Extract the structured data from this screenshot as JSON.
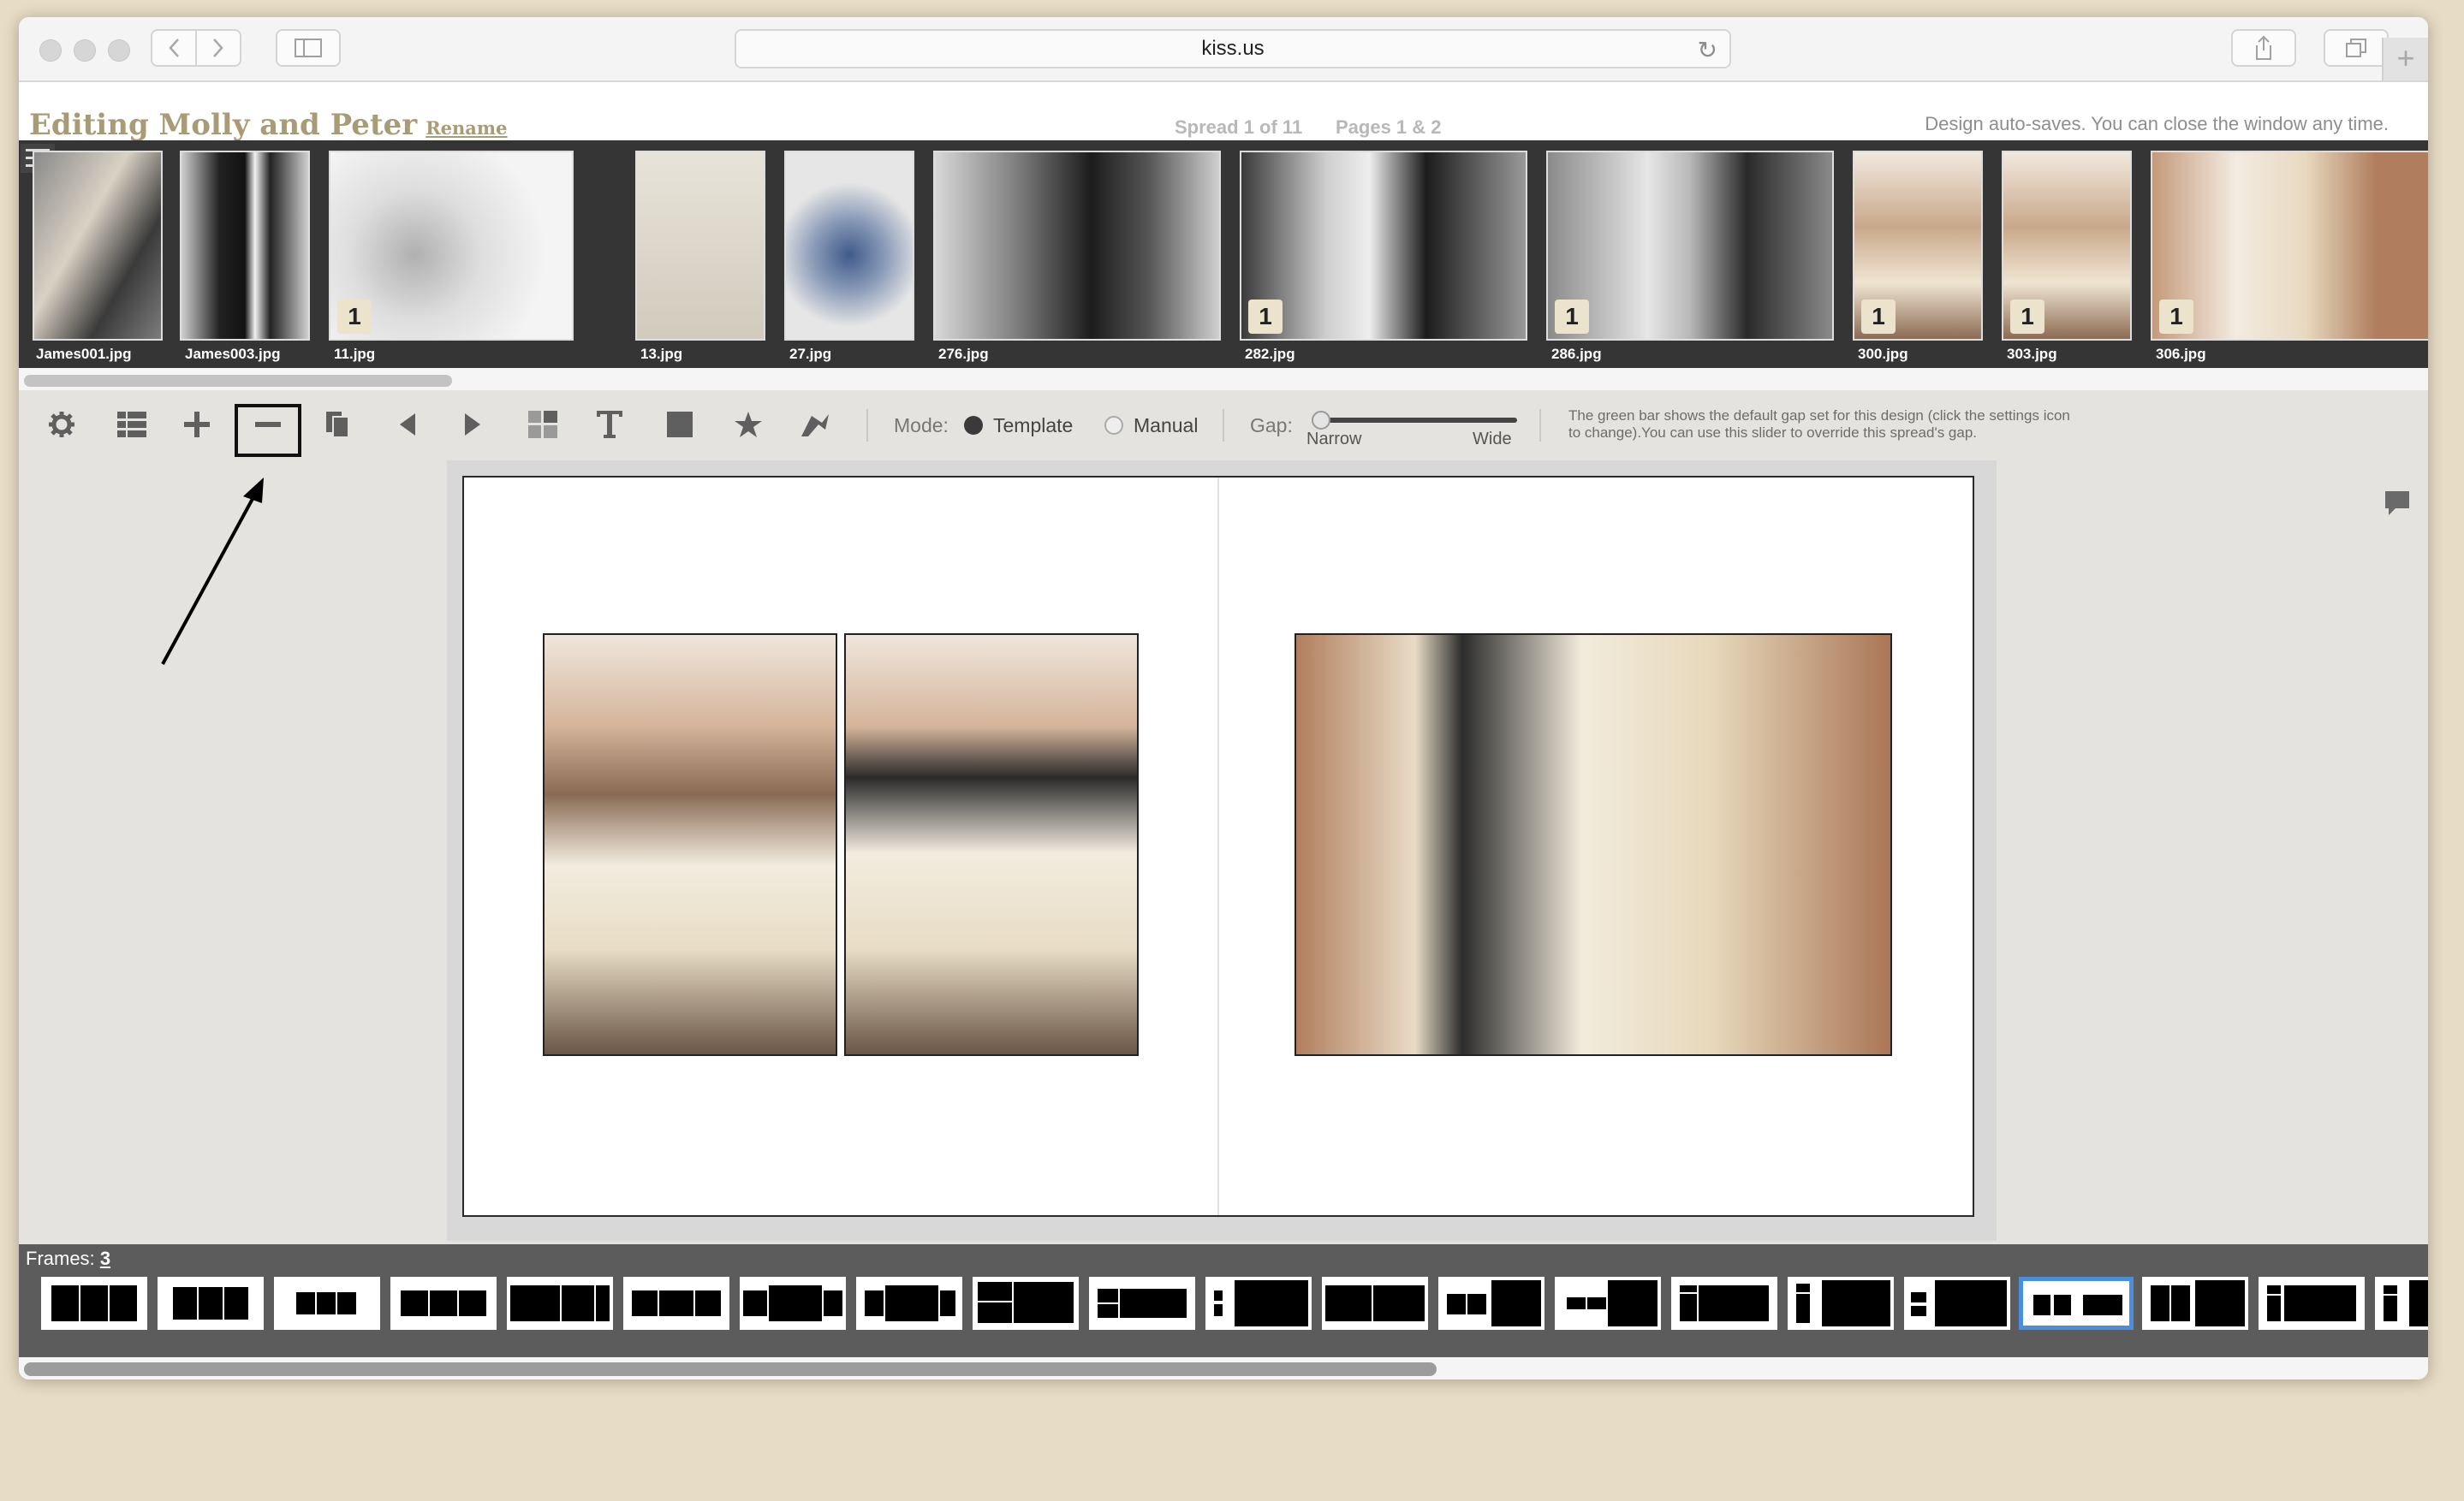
{
  "browser": {
    "url": "kiss.us"
  },
  "header": {
    "title": "Editing Molly and Peter",
    "rename_label": "Rename",
    "spread": "Spread 1 of 11",
    "pages": "Pages 1 & 2",
    "autosave_note": "Design auto-saves. You can close the window any time."
  },
  "thumbnails": [
    {
      "label": "James001.jpg",
      "badge": ""
    },
    {
      "label": "James003.jpg",
      "badge": ""
    },
    {
      "label": "11.jpg",
      "badge": "1"
    },
    {
      "label": "13.jpg",
      "badge": ""
    },
    {
      "label": "27.jpg",
      "badge": ""
    },
    {
      "label": "276.jpg",
      "badge": ""
    },
    {
      "label": "282.jpg",
      "badge": "1"
    },
    {
      "label": "286.jpg",
      "badge": "1"
    },
    {
      "label": "300.jpg",
      "badge": "1"
    },
    {
      "label": "303.jpg",
      "badge": "1"
    },
    {
      "label": "306.jpg",
      "badge": "1"
    }
  ],
  "toolbar": {
    "mode_label": "Mode:",
    "mode_template": "Template",
    "mode_manual": "Manual",
    "mode_selected": "Template",
    "gap_label": "Gap:",
    "gap_narrow": "Narrow",
    "gap_wide": "Wide",
    "gap_hint": "The green bar shows the default gap set for this design (click the settings icon to change).You can use this slider to override this spread's gap."
  },
  "frames": {
    "label": "Frames:",
    "count": "3",
    "selected_index": 17
  },
  "colors": {
    "title_gold": "#a99b75",
    "strip_bg": "#353535",
    "workspace_bg": "#e5e3e0",
    "frames_bar_bg": "#5c5c5c",
    "selected_frame": "#4a8ee0",
    "badge_bg": "#ebe3cc"
  },
  "icons": [
    "settings-icon",
    "grid-icon",
    "add-icon",
    "remove-icon",
    "copy-icon",
    "prev-spread-icon",
    "next-spread-icon",
    "layout-icon",
    "text-icon",
    "box-icon",
    "star-icon",
    "undo-icon",
    "comment-icon"
  ]
}
